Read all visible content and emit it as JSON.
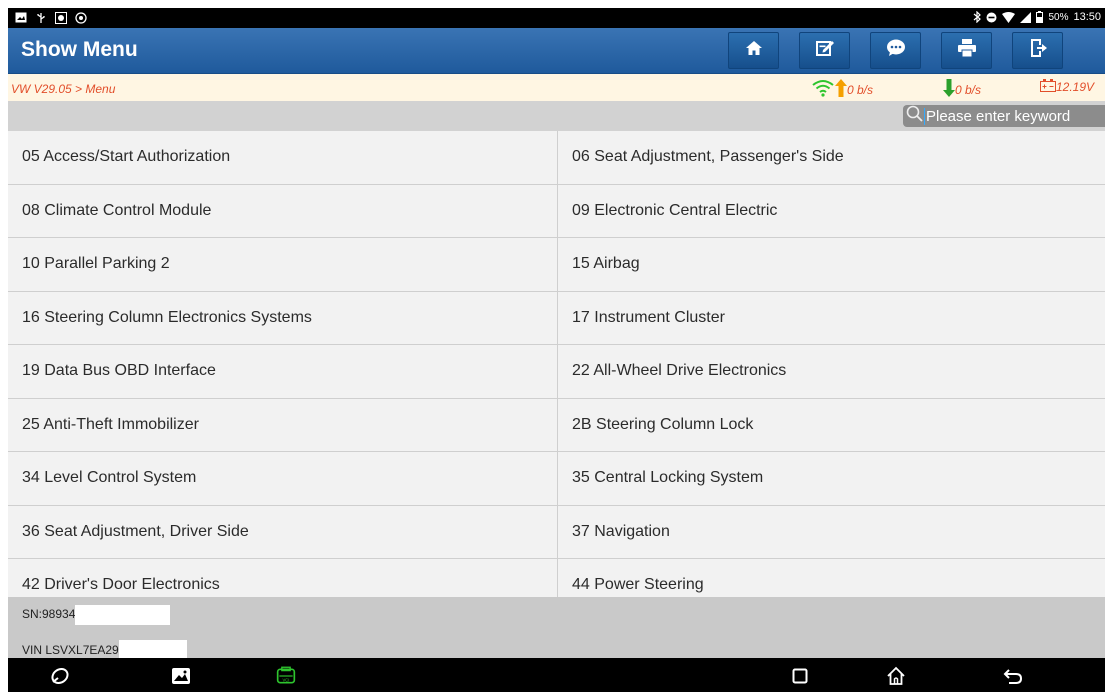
{
  "status_bar": {
    "left_icons": [
      "image-notification-icon",
      "usb-icon",
      "app-notification-icon",
      "settings-notification-icon"
    ],
    "right_icons": [
      "bluetooth-icon",
      "do-not-disturb-icon",
      "wifi-icon",
      "signal-icon",
      "battery-icon"
    ],
    "battery": "50%",
    "time": "13:50"
  },
  "titlebar": {
    "title": "Show Menu",
    "buttons": [
      "home-icon",
      "edit-icon",
      "message-icon",
      "print-icon",
      "exit-icon"
    ]
  },
  "crumb": {
    "path": "VW V29.05 > Menu",
    "upload_rate": "0 b/s",
    "download_rate": "0 b/s",
    "voltage": "12.19V"
  },
  "search": {
    "placeholder": "Please enter keyword"
  },
  "menu": {
    "items": [
      "05 Access/Start Authorization",
      "06 Seat Adjustment, Passenger's Side",
      "08 Climate Control Module",
      "09 Electronic Central Electric",
      "10 Parallel Parking 2",
      "15 Airbag",
      "16 Steering Column Electronics Systems",
      "17 Instrument Cluster",
      "19 Data Bus OBD Interface",
      "22 All-Wheel Drive Electronics",
      "25 Anti-Theft Immobilizer",
      "2B Steering Column Lock",
      "34 Level Control System",
      "35 Central Locking System",
      "36 Seat Adjustment, Driver Side",
      "37 Navigation",
      "42 Driver's Door Electronics",
      "44 Power Steering"
    ]
  },
  "info": {
    "sn": "SN:98934",
    "vin": "VIN LSVXL7EA29"
  },
  "navbar": {
    "icons": [
      "browser-icon",
      "gallery-icon",
      "vci-icon",
      "recents-icon",
      "home-nav-icon",
      "back-icon"
    ],
    "vci_label": "VCI"
  },
  "colors": {
    "titlebar": "#2a67a8",
    "accent_orange": "#e24e2a",
    "wifi_green": "#2ec52e",
    "down_green": "#2ca02c",
    "up_orange": "#f5a000"
  }
}
